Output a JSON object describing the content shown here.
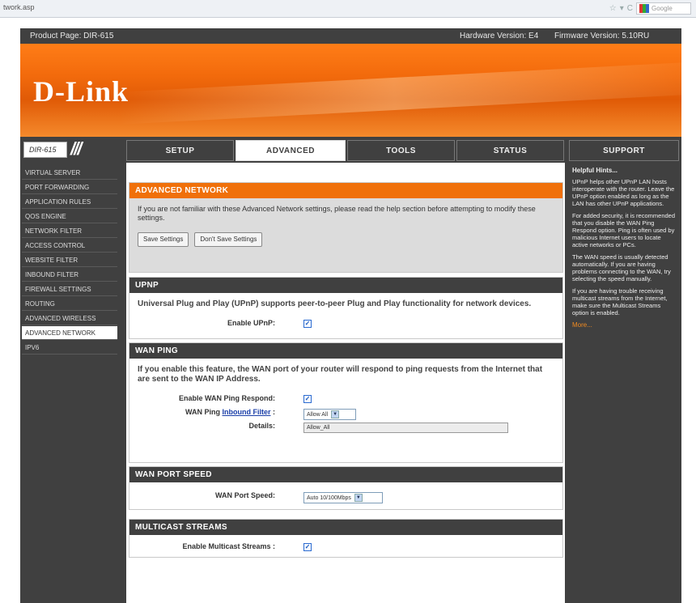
{
  "browser": {
    "url": "twork.asp",
    "search_placeholder": "Google"
  },
  "header": {
    "product_page": "Product Page: DIR-615",
    "hardware_version": "Hardware Version: E4",
    "firmware_version": "Firmware Version: 5.10RU",
    "logo": "D-Link",
    "model": "DIR-615",
    "model_slashes": "///"
  },
  "nav": {
    "tabs": [
      {
        "label": "SETUP"
      },
      {
        "label": "ADVANCED"
      },
      {
        "label": "TOOLS"
      },
      {
        "label": "STATUS"
      },
      {
        "label": "SUPPORT"
      }
    ],
    "active": "ADVANCED"
  },
  "sidebar": {
    "items": [
      {
        "label": "VIRTUAL SERVER"
      },
      {
        "label": "PORT FORWARDING"
      },
      {
        "label": "APPLICATION RULES"
      },
      {
        "label": "QOS ENGINE"
      },
      {
        "label": "NETWORK FILTER"
      },
      {
        "label": "ACCESS CONTROL"
      },
      {
        "label": "WEBSITE FILTER"
      },
      {
        "label": "INBOUND FILTER"
      },
      {
        "label": "FIREWALL SETTINGS"
      },
      {
        "label": "ROUTING"
      },
      {
        "label": "ADVANCED WIRELESS"
      },
      {
        "label": "ADVANCED NETWORK"
      },
      {
        "label": "IPV6"
      }
    ],
    "active": "ADVANCED NETWORK"
  },
  "advanced_network": {
    "title": "ADVANCED NETWORK",
    "description": "If you are not familiar with these Advanced Network settings, please read the help section before attempting to modify these settings.",
    "save_button": "Save Settings",
    "dont_save_button": "Don't Save Settings"
  },
  "upnp": {
    "title": "UPNP",
    "description": "Universal Plug and Play (UPnP) supports peer-to-peer Plug and Play functionality for network devices.",
    "enable_label": "Enable UPnP:",
    "enabled": true
  },
  "wan_ping": {
    "title": "WAN PING",
    "description": "If you enable this feature, the WAN port of your router will respond to ping requests from the Internet that are sent to the WAN IP Address.",
    "respond_label": "Enable WAN Ping Respond:",
    "respond_enabled": true,
    "filter_label_prefix": "WAN Ping",
    "filter_link": "Inbound Filter",
    "filter_label_suffix": ":",
    "filter_value": "Allow All",
    "details_label": "Details:",
    "details_value": "Allow_All"
  },
  "wan_port_speed": {
    "title": "WAN PORT SPEED",
    "label": "WAN Port Speed:",
    "value": "Auto 10/100Mbps"
  },
  "multicast": {
    "title": "MULTICAST STREAMS",
    "label": "Enable Multicast Streams :",
    "enabled": true
  },
  "hints": {
    "title": "Helpful Hints...",
    "paragraphs": [
      "UPnP helps other UPnP LAN hosts interoperate with the router. Leave the UPnP option enabled as long as the LAN has other UPnP applications.",
      "For added security, it is recommended that you disable the WAN Ping Respond option. Ping is often used by malicious Internet users to locate active networks or PCs.",
      "The WAN speed is usually detected automatically. If you are having problems connecting to the WAN, try selecting the speed manually.",
      "If you are having trouble receiving multicast streams from the Internet, make sure the Multicast Streams option is enabled."
    ],
    "more": "More..."
  },
  "checkmark": "✓",
  "dropdown_arrow": "▼",
  "colors": {
    "orange": "#f0700a",
    "dark": "#404040"
  }
}
